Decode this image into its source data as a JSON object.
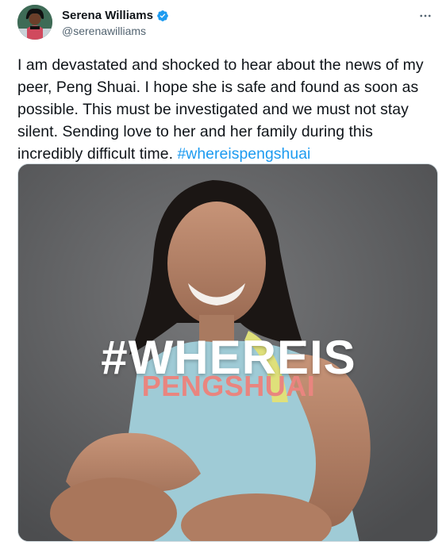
{
  "author": {
    "display_name": "Serena Williams",
    "handle": "@serenawilliams",
    "verified_icon": "verified-badge-icon",
    "more_icon": "more-options-icon"
  },
  "tweet": {
    "body": "I am devastated and shocked to hear about the news of my peer, Peng Shuai. I hope she is safe and found as soon as possible. This must be investigated and we must not stay silent. Sending love to her and her family during this incredibly difficult time. ",
    "hashtag": "#whereispengshuai"
  },
  "media": {
    "overlay_line1": "#WHEREIS",
    "overlay_line2": "PENGSHUAI"
  },
  "colors": {
    "hashtag": "#1d9bf0",
    "verified": "#1d9bf0",
    "overlay_pink": "#e9857f"
  }
}
